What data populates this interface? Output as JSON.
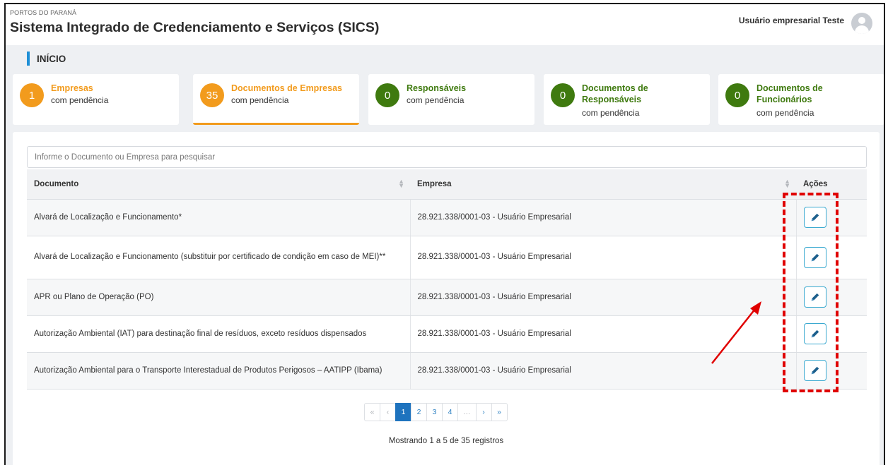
{
  "header": {
    "org": "PORTOS DO PARANÁ",
    "title": "Sistema Integrado de Credenciamento e Serviços (SICS)",
    "user": "Usuário empresarial Teste"
  },
  "section": {
    "title": "INÍCIO"
  },
  "cards": [
    {
      "count": "1",
      "title": "Empresas",
      "subtitle": "com pendência",
      "color": "#f29b1d"
    },
    {
      "count": "35",
      "title": "Documentos de Empresas",
      "subtitle": "com pendência",
      "color": "#f29b1d",
      "active": true
    },
    {
      "count": "0",
      "title": "Responsáveis",
      "subtitle": "com pendência",
      "color": "#3f7a0f"
    },
    {
      "count": "0",
      "title_line1": "Documentos de",
      "title_line2": "Responsáveis",
      "subtitle": "com pendência",
      "color": "#3f7a0f"
    },
    {
      "count": "0",
      "title_line1": "Documentos de",
      "title_line2": "Funcionários",
      "subtitle": "com pendência",
      "color": "#3f7a0f"
    }
  ],
  "search": {
    "placeholder": "Informe o Documento ou Empresa para pesquisar"
  },
  "table": {
    "columns": [
      "Documento",
      "Empresa",
      "Ações"
    ],
    "rows": [
      {
        "documento": "Alvará de Localização e Funcionamento*",
        "empresa": "28.921.338/0001-03 - Usuário Empresarial"
      },
      {
        "documento": "Alvará de Localização e Funcionamento (substituir por certificado de condição em caso de MEI)**",
        "empresa": "28.921.338/0001-03 - Usuário Empresarial"
      },
      {
        "documento": "APR ou Plano de Operação (PO)",
        "empresa": "28.921.338/0001-03 - Usuário Empresarial"
      },
      {
        "documento": "Autorização Ambiental (IAT) para destinação final de resíduos, exceto resíduos dispensados",
        "empresa": "28.921.338/0001-03 - Usuário Empresarial"
      },
      {
        "documento": "Autorização Ambiental para o Transporte Interestadual de Produtos Perigosos – AATIPP (Ibama)",
        "empresa": "28.921.338/0001-03 - Usuário Empresarial"
      }
    ],
    "edit_icon": "pencil-icon"
  },
  "pagination": {
    "first": "«",
    "prev": "‹",
    "pages": [
      "1",
      "2",
      "3",
      "4"
    ],
    "ellipsis": "…",
    "next": "›",
    "last": "»",
    "current": "1"
  },
  "footer": {
    "showing": "Mostrando 1 a 5 de 35 registros"
  },
  "colors": {
    "orange": "#f29b1d",
    "green": "#3f7a0f",
    "blue": "#1e8fd6",
    "annotation": "#e00000"
  }
}
